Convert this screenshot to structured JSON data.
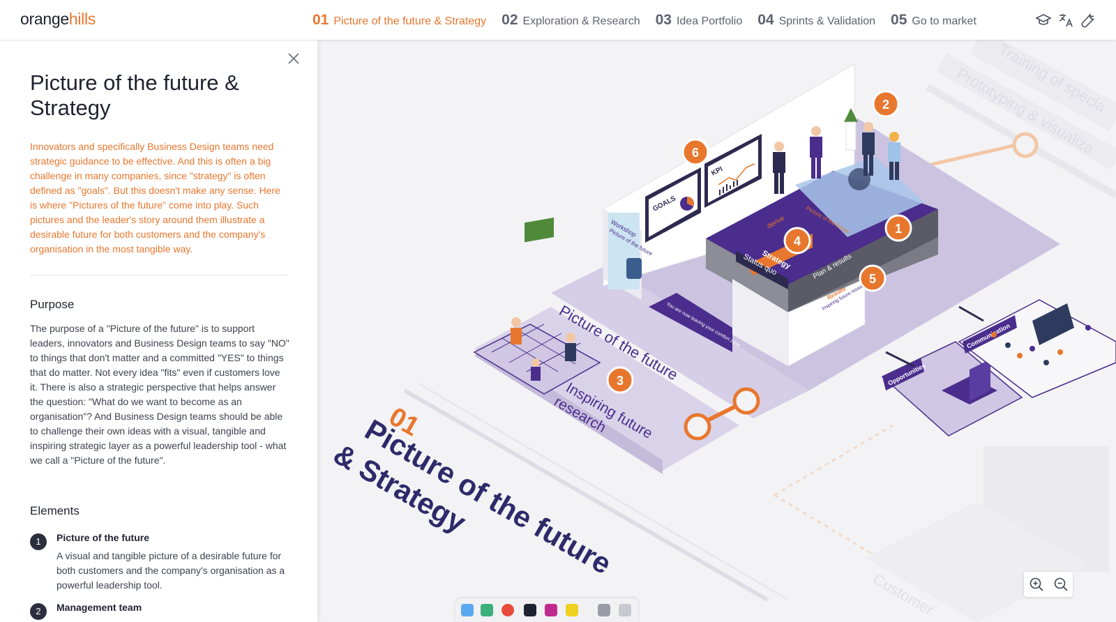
{
  "logo": {
    "part1": "orange",
    "part2": "hills"
  },
  "nav": [
    {
      "num": "01",
      "label": "Picture of the future & Strategy",
      "active": true
    },
    {
      "num": "02",
      "label": "Exploration & Research"
    },
    {
      "num": "03",
      "label": "Idea Portfolio"
    },
    {
      "num": "04",
      "label": "Sprints & Validation"
    },
    {
      "num": "05",
      "label": "Go to market"
    }
  ],
  "nav_icons": [
    "graduation-cap-icon",
    "translate-icon",
    "wrench-icon"
  ],
  "panel": {
    "title": "Picture of the future & Strategy",
    "intro": "Innovators and specifically Business Design teams need strategic guidance to be effective. And this is often a big challenge in many companies, since \"strategy\" is often defined as \"goals\". But this doesn't make any sense. Here is where \"Pictures of the future\" come into play. Such pictures and the leader's story around them illustrate a desirable future for both customers and the company's organisation in the most tangible way.",
    "purpose_heading": "Purpose",
    "purpose_text": "The purpose of a \"Picture of the future\" is to support leaders, innovators and Business Design teams to say \"NO\" to things that don't matter and a committed \"YES\" to things that do matter. Not every idea \"fits\" even if customers love it. There is also a strategic perspective that helps answer the question: \"What do we want to become as an organisation\"? And Business Design teams should be able to challenge their own ideas with a visual, tangible and inspiring strategic layer as a powerful leadership tool - what we call a \"Picture of the future\".",
    "elements_heading": "Elements",
    "elements": [
      {
        "num": "1",
        "title": "Picture of the future",
        "desc": "A visual and tangible picture of a desirable future for both customers and the company's organisation as a powerful leadership tool."
      },
      {
        "num": "2",
        "title": "Management team",
        "desc": ""
      }
    ]
  },
  "map": {
    "big_number": "01",
    "big_title_line1": "Picture of the future",
    "big_title_line2": "& Strategy",
    "floor_label": "Picture of the future",
    "research_label_line1": "Inspiring future",
    "research_label_line2": "research",
    "markers": [
      "1",
      "2",
      "3",
      "4",
      "5",
      "6"
    ],
    "board": {
      "strategy": "Strategy",
      "status_quo": "Status quo",
      "plan": "Plan & results",
      "derive": "derive",
      "goals": "GOALS",
      "kpi": "KPI",
      "results": "Results",
      "results_sub": "Inspiring future research",
      "workshop": "Workshop",
      "workshop_sub": "Picture of the future",
      "board_title": "Picture of the future",
      "banner": "You are now leaving your comfort zone"
    },
    "right_labels": {
      "opportunities": "Opportunities",
      "communication": "Communication",
      "training": "Training of specia",
      "prototyping": "Prototyping & visualiza",
      "customer": "Customer"
    }
  },
  "colors": {
    "accent": "#e8772e",
    "purple": "#4a2d8c",
    "lavender": "#cbc3e0",
    "dark": "#1f2230"
  },
  "zoom_icons": [
    "zoom-in-icon",
    "zoom-out-icon"
  ]
}
